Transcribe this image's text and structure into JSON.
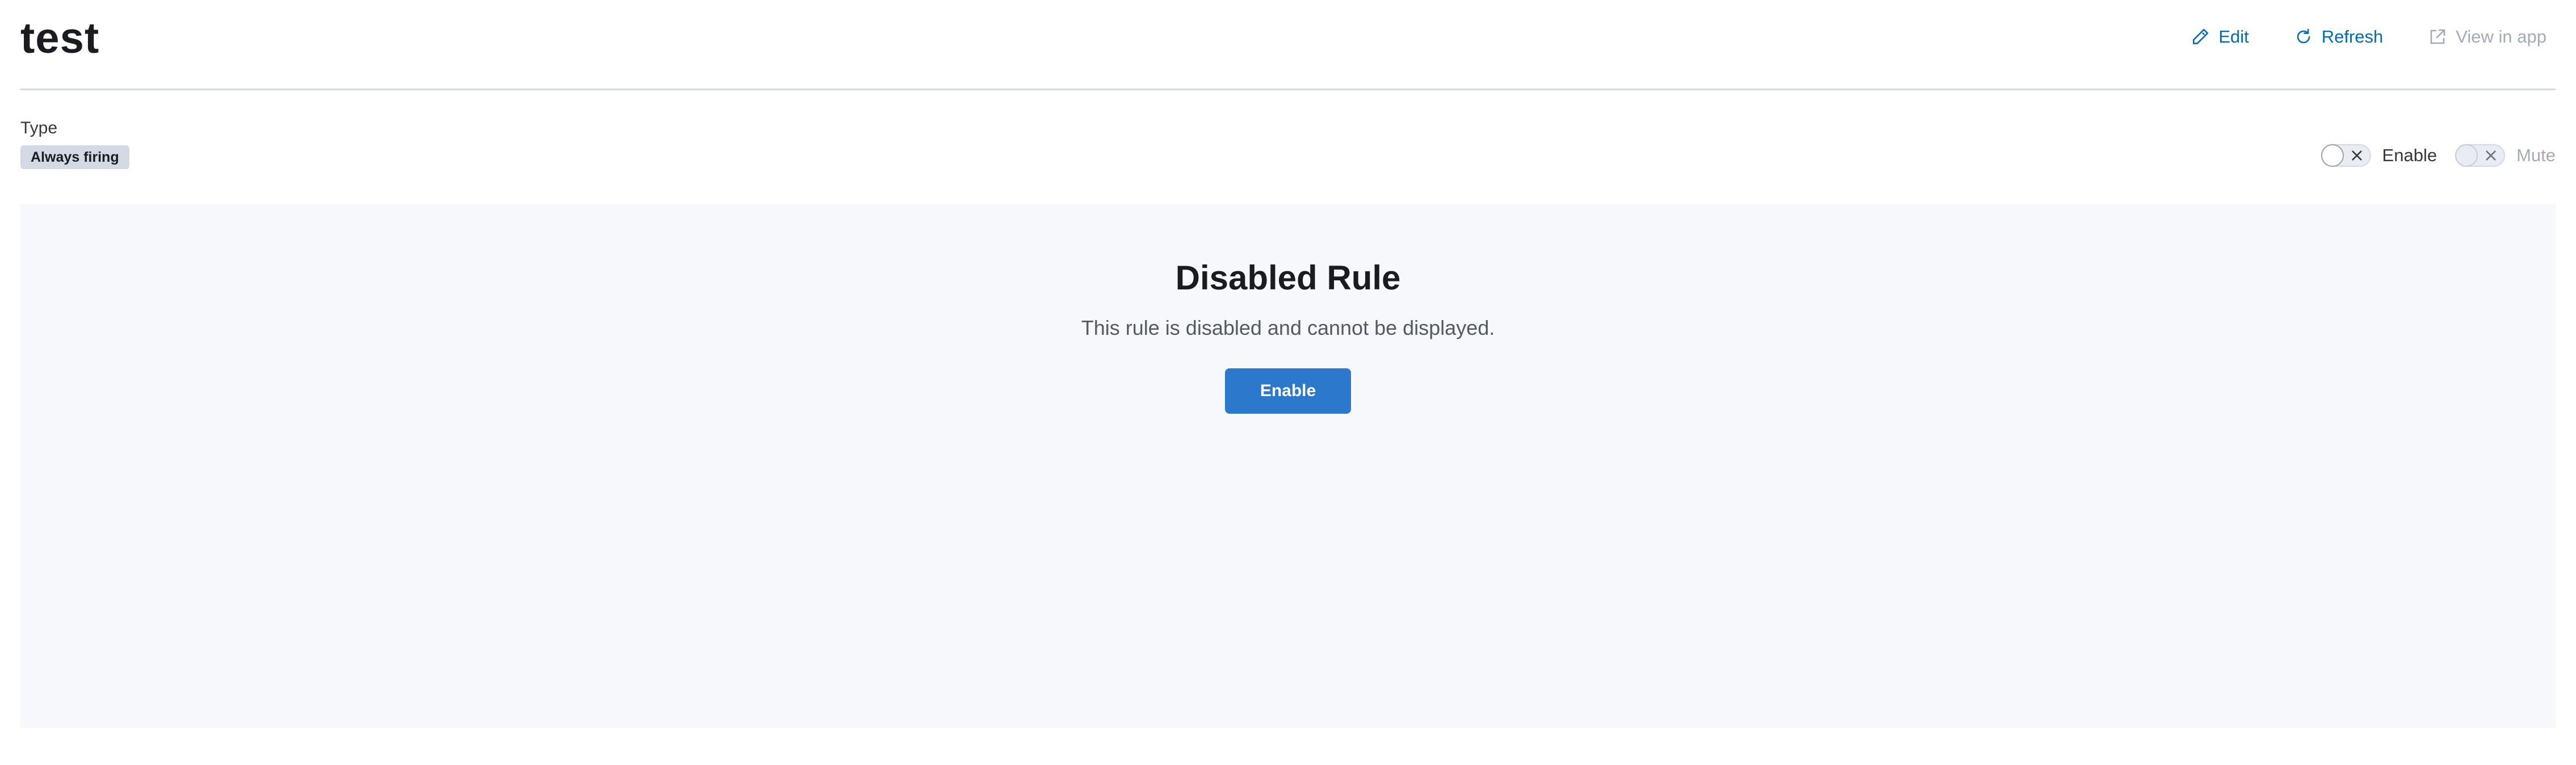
{
  "header": {
    "title": "test",
    "actions": [
      {
        "label": "Edit",
        "icon": "pencil-icon",
        "enabled": true
      },
      {
        "label": "Refresh",
        "icon": "refresh-icon",
        "enabled": true
      },
      {
        "label": "View in app",
        "icon": "external-link-icon",
        "enabled": false
      }
    ]
  },
  "rule_type": {
    "label": "Type",
    "badge": "Always firing"
  },
  "switches": [
    {
      "label": "Enable",
      "checked": false,
      "enabled": true
    },
    {
      "label": "Mute",
      "checked": false,
      "enabled": false
    }
  ],
  "empty_state": {
    "title": "Disabled Rule",
    "body": "This rule is disabled and cannot be displayed.",
    "button_label": "Enable"
  },
  "colors": {
    "link": "#006bb8",
    "disabled_text": "#a2abba",
    "primary_button": "#2b78cc",
    "panel_bg": "#f7f8fc",
    "badge_bg": "#d3dae6"
  }
}
